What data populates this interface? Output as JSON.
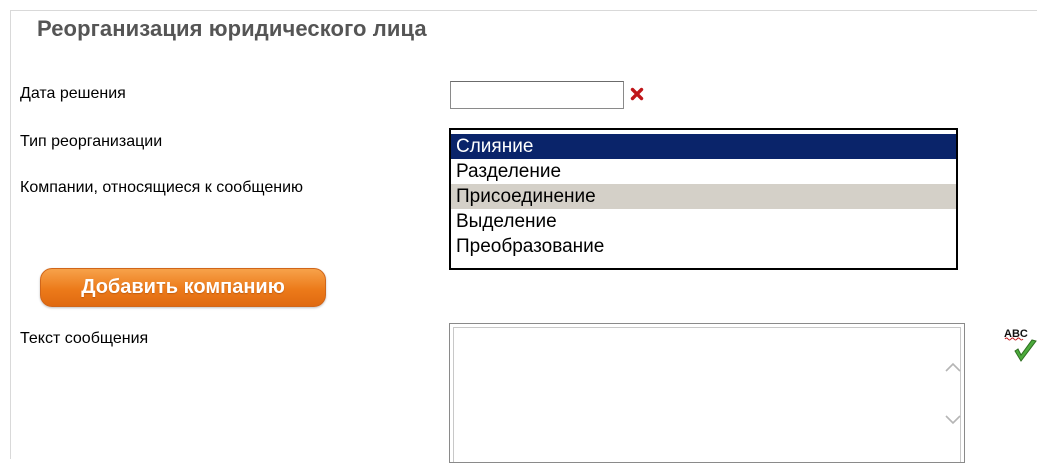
{
  "header": {
    "title": "Реорганизация юридического лица"
  },
  "form": {
    "decision_date_label": "Дата решения",
    "decision_date_value": "",
    "reorg_type_label": "Тип реорганизации",
    "companies_label": "Компании, относящиеся к сообщению",
    "reorg_options": [
      {
        "label": "Слияние",
        "state": "selected"
      },
      {
        "label": "Разделение",
        "state": "normal"
      },
      {
        "label": "Присоединение",
        "state": "hover"
      },
      {
        "label": "Выделение",
        "state": "normal"
      },
      {
        "label": "Преобразование",
        "state": "normal"
      }
    ],
    "add_company_button": "Добавить компанию",
    "message_text_label": "Текст сообщения",
    "message_text_value": "",
    "spellcheck_icon_text": "ABC"
  },
  "colors": {
    "selected_bg": "#0a246a",
    "hover_bg": "#d4d0c8",
    "button_orange": "#ec7a1a",
    "clear_red": "#c0161a",
    "title_gray": "#555555"
  }
}
